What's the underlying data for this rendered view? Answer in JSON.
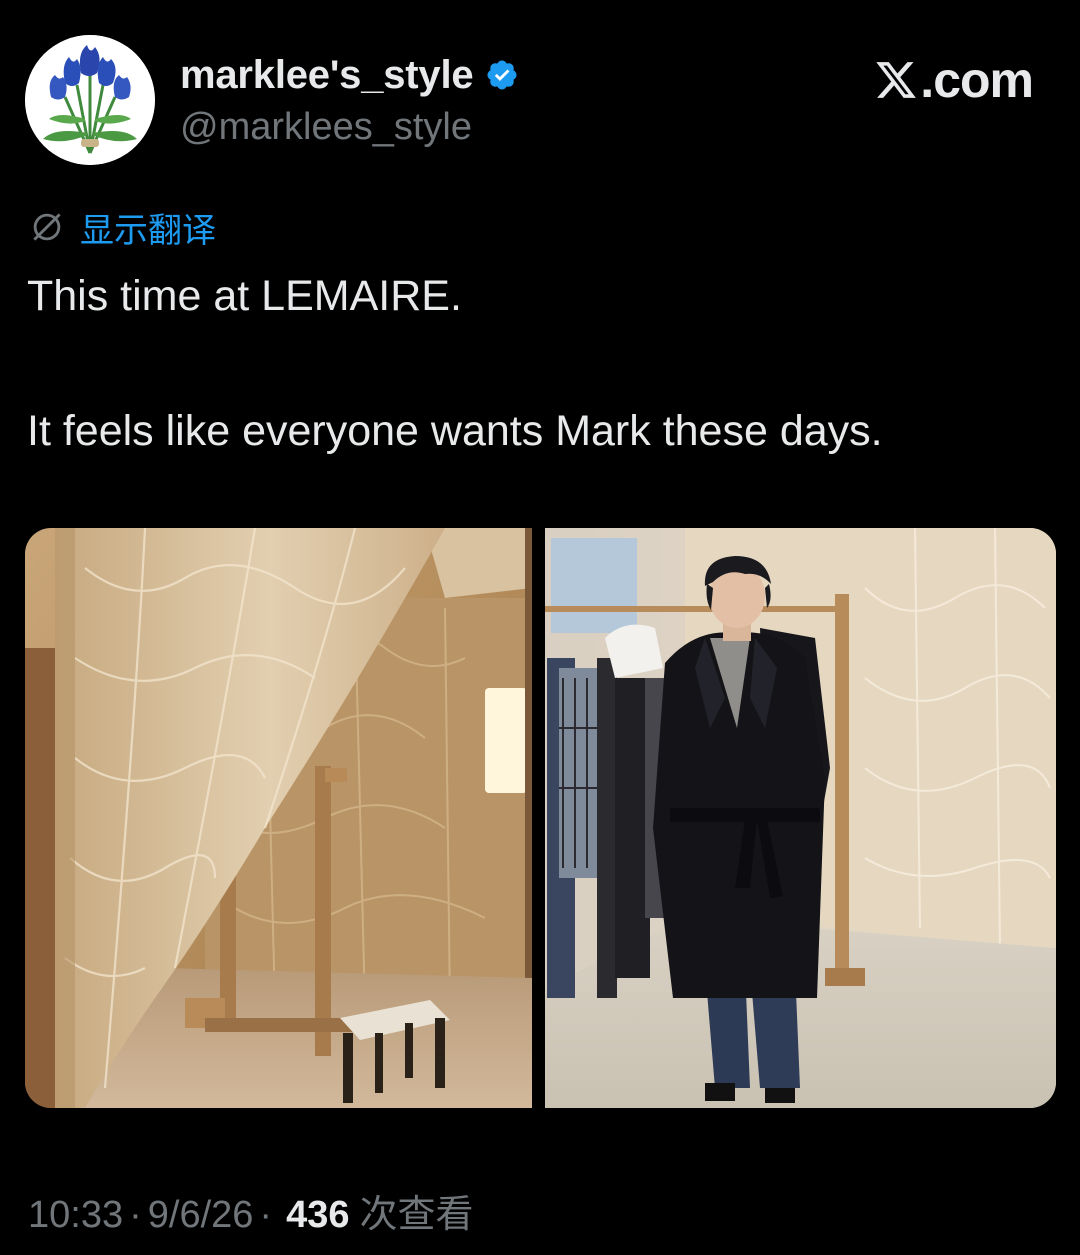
{
  "brand": {
    "label": ".com",
    "logo_icon": "x-logo-icon"
  },
  "author": {
    "display_name": "marklee's_style",
    "handle": "@marklees_style",
    "verified": true,
    "verified_color": "#1d9bf0",
    "avatar_icon": "blue-tulip-bouquet-icon"
  },
  "translate": {
    "label": "显示翻译",
    "icon": "translate-slashed-circle-icon",
    "color": "#1d9bf0"
  },
  "tweet": {
    "line1": "This time at LEMAIRE.",
    "line2": "It feels like everyone wants Mark these days."
  },
  "media": [
    {
      "name": "fitting-room-curtain-photo"
    },
    {
      "name": "man-in-black-coat-photo"
    }
  ],
  "meta": {
    "time": "10:33",
    "date": "9/6/26",
    "views": "436",
    "views_label": "次查看"
  },
  "colors": {
    "background": "#000000",
    "text": "#e7e9ea",
    "muted": "#71767b",
    "accent": "#1d9bf0"
  }
}
